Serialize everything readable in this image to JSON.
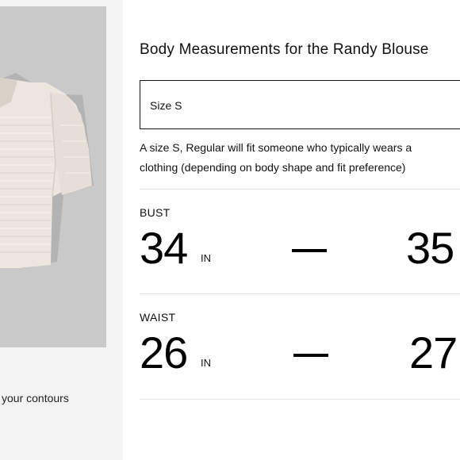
{
  "left": {
    "caption": "your contours"
  },
  "main": {
    "title": "Body Measurements for the Randy Blouse",
    "size_select": {
      "value": "Size S"
    },
    "description": {
      "line1": "A size S, Regular will fit someone who typically wears a",
      "line2": "clothing (depending on body shape and fit preference)"
    },
    "measurements": [
      {
        "label": "BUST",
        "min": "34",
        "min_unit": "IN",
        "max": "35"
      },
      {
        "label": "WAIST",
        "min": "26",
        "min_unit": "IN",
        "max": "27"
      }
    ]
  },
  "colors": {
    "panel_background": "#f3f3f3",
    "image_background": "#c9c9c9",
    "garment": "#efe9e3"
  },
  "icons": {
    "dash": "em-dash"
  }
}
